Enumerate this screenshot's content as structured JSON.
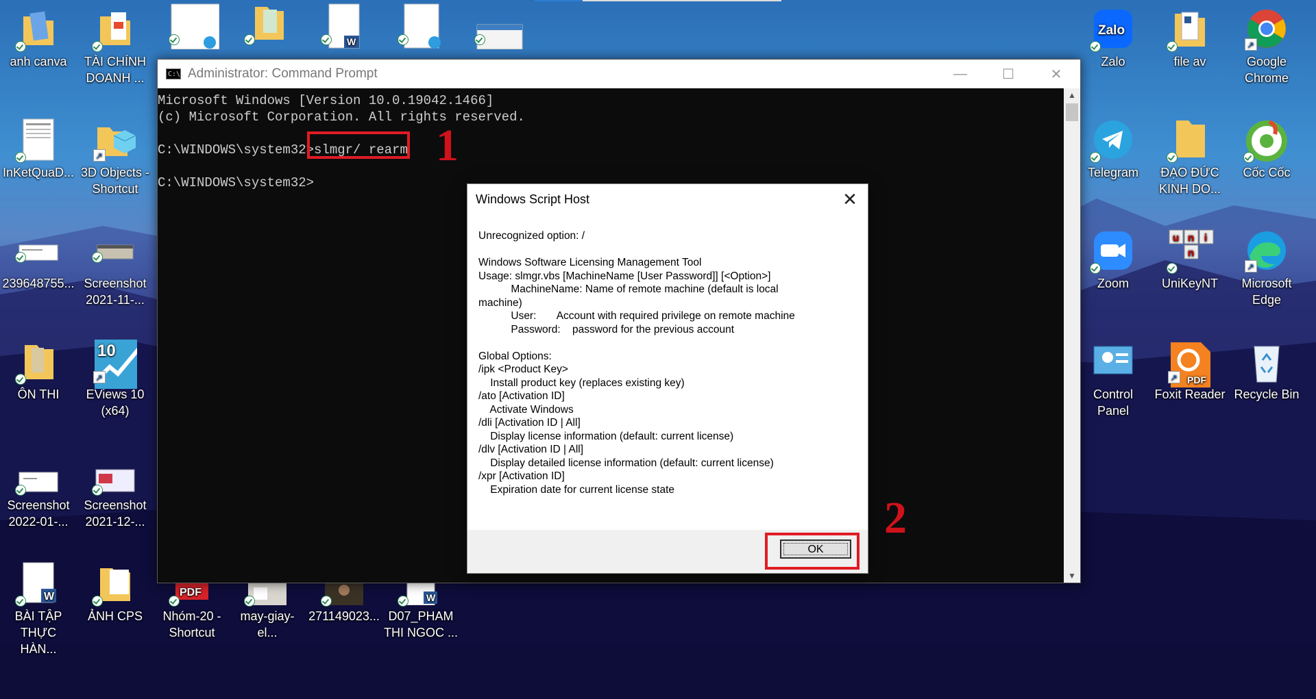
{
  "desktop": {
    "left_icons": [
      {
        "label": "anh canva",
        "icon": "folder-icon"
      },
      {
        "label": "TÀI CHÍNH DOANH ...",
        "icon": "folder-icon"
      },
      {
        "label": "InKetQuaD...",
        "icon": "document-icon"
      },
      {
        "label": "3D Objects - Shortcut",
        "icon": "folder-3d-icon"
      },
      {
        "label": "239648755...",
        "icon": "image-icon"
      },
      {
        "label": "Screenshot 2021-11-...",
        "icon": "image-icon"
      },
      {
        "label": "ÔN THI",
        "icon": "folder-icon"
      },
      {
        "label": "EViews 10 (x64)",
        "icon": "eviews-icon"
      },
      {
        "label": "Screenshot 2022-01-...",
        "icon": "image-icon"
      },
      {
        "label": "Screenshot 2021-12-...",
        "icon": "image-icon"
      },
      {
        "label": "BÀI TẬP THỰC HÀN...",
        "icon": "word-doc-icon"
      },
      {
        "label": "ẢNH CPS",
        "icon": "folder-icon"
      },
      {
        "label": "Nhóm-20 - Shortcut",
        "icon": "pdf-icon"
      },
      {
        "label": "may-giay-el...",
        "icon": "image-icon"
      },
      {
        "label": "271149023...",
        "icon": "image-icon"
      },
      {
        "label": "D07_PHAM THI NGOC ...",
        "icon": "word-doc-icon"
      }
    ],
    "right_icons": [
      {
        "label": "Zalo",
        "icon": "zalo-icon"
      },
      {
        "label": "file av",
        "icon": "folder-icon"
      },
      {
        "label": "Google Chrome",
        "icon": "chrome-icon"
      },
      {
        "label": "Telegram",
        "icon": "telegram-icon"
      },
      {
        "label": "ĐẠO ĐỨC KINH DO...",
        "icon": "folder-icon"
      },
      {
        "label": "Cốc Cốc",
        "icon": "coccoc-icon"
      },
      {
        "label": "Zoom",
        "icon": "zoom-icon"
      },
      {
        "label": "UniKeyNT",
        "icon": "unikey-icon"
      },
      {
        "label": "Microsoft Edge",
        "icon": "edge-icon"
      },
      {
        "label": "Control Panel",
        "icon": "control-panel-icon"
      },
      {
        "label": "Foxit Reader",
        "icon": "foxit-icon"
      },
      {
        "label": "Recycle Bin",
        "icon": "recycle-bin-icon"
      }
    ],
    "unikey_letters": [
      "u",
      "n",
      "i",
      "n"
    ],
    "eviews_number": "10",
    "zalo_text": "Zalo",
    "pdf_text": "PDF"
  },
  "cmd": {
    "title": "Administrator: Command Prompt",
    "icon_text": "C:\\.",
    "lines": [
      "Microsoft Windows [Version 10.0.19042.1466]",
      "(c) Microsoft Corporation. All rights reserved.",
      "",
      "C:\\WINDOWS\\system32>slmgr/ rearm",
      "",
      "C:\\WINDOWS\\system32>"
    ],
    "minimize": "—",
    "maximize": "☐",
    "close": "✕"
  },
  "annotations": {
    "step1": "1",
    "step2": "2"
  },
  "dialog": {
    "title": "Windows Script Host",
    "close": "✕",
    "message_lines": [
      "Unrecognized option: /",
      "",
      "Windows Software Licensing Management Tool",
      "Usage: slmgr.vbs [MachineName [User Password]] [<Option>]",
      "           MachineName: Name of remote machine (default is local",
      "machine)",
      "           User:       Account with required privilege on remote machine",
      "           Password:    password for the previous account",
      "",
      "Global Options:",
      "/ipk <Product Key>",
      "    Install product key (replaces existing key)",
      "/ato [Activation ID]",
      "    Activate Windows",
      "/dli [Activation ID | All]",
      "    Display license information (default: current license)",
      "/dlv [Activation ID | All]",
      "    Display detailed license information (default: current license)",
      "/xpr [Activation ID]",
      "    Expiration date for current license state"
    ],
    "ok_label": "OK"
  }
}
